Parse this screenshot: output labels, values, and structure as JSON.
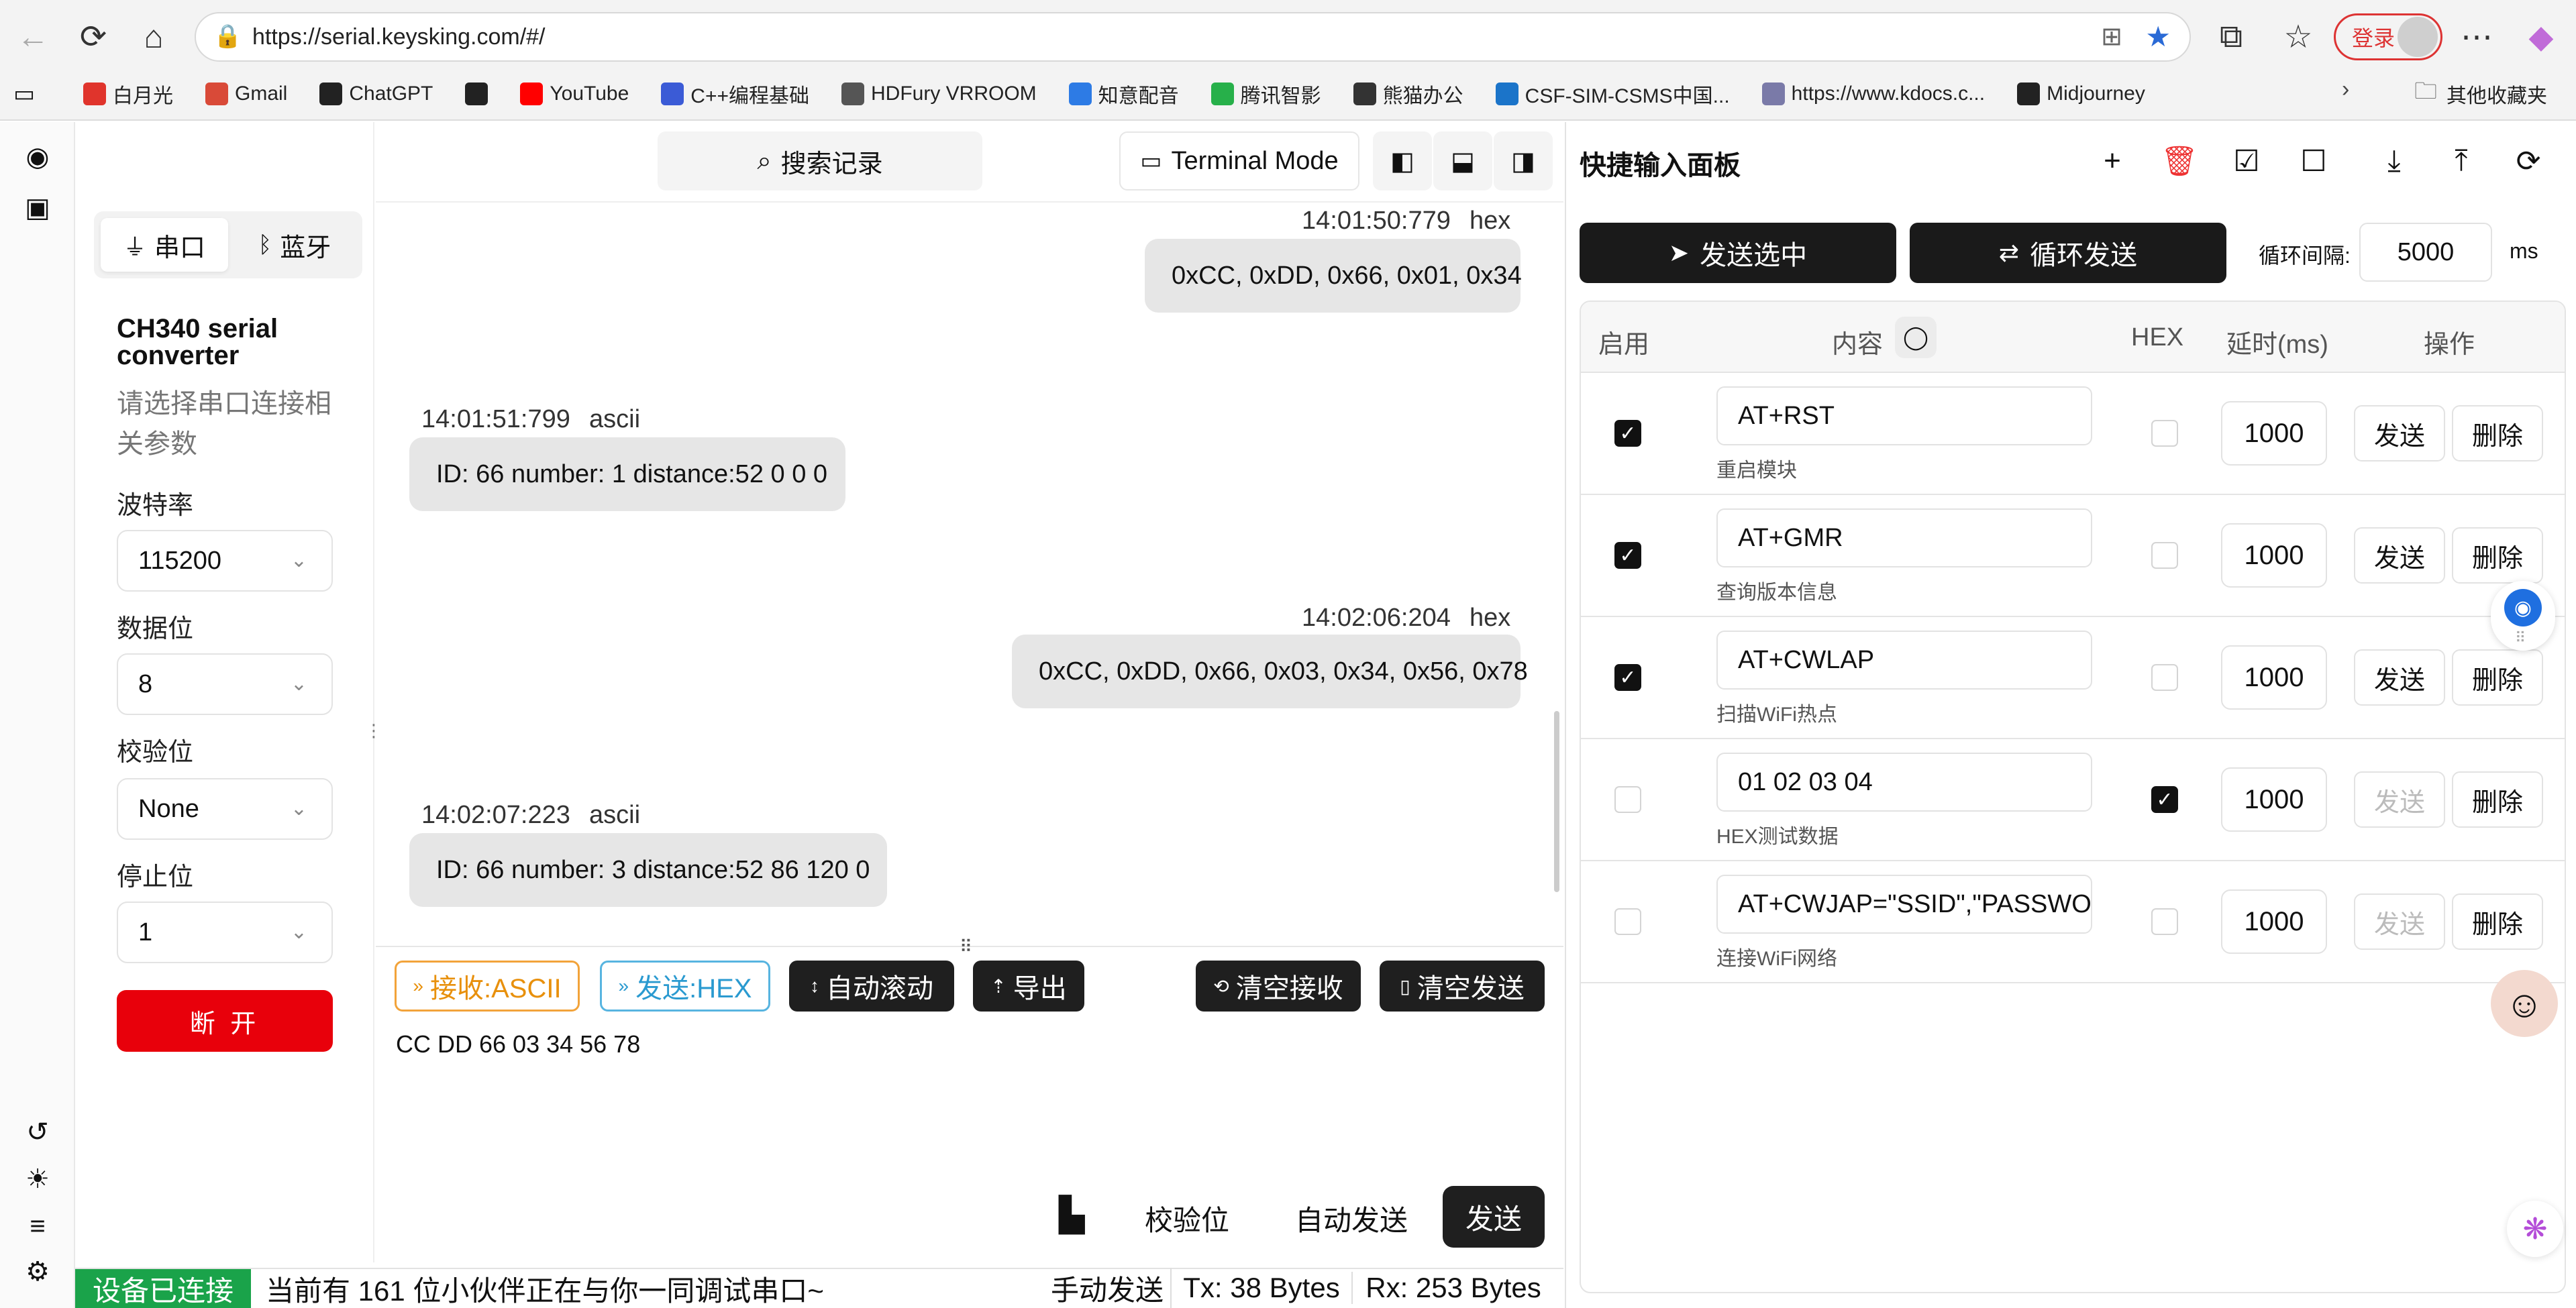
{
  "browser": {
    "url": "https://serial.keysking.com/#/",
    "login_label": "登录",
    "bookmarks": [
      {
        "label": "白月光",
        "color": "#e0342c"
      },
      {
        "label": "Gmail",
        "color": "#d94a38"
      },
      {
        "label": "ChatGPT",
        "color": "#222222"
      },
      {
        "label": "",
        "color": "#222222"
      },
      {
        "label": "YouTube",
        "color": "#ff0000"
      },
      {
        "label": "C++编程基础",
        "color": "#3b5bd6"
      },
      {
        "label": "HDFury VRROOM",
        "color": "#555555"
      },
      {
        "label": "知意配音",
        "color": "#2d7be5"
      },
      {
        "label": "腾讯智影",
        "color": "#27b04a"
      },
      {
        "label": "熊猫办公",
        "color": "#333333"
      },
      {
        "label": "CSF-SIM-CSMS中国...",
        "color": "#1b74c9"
      },
      {
        "label": "https://www.kdocs.c...",
        "color": "#7a7aa8"
      },
      {
        "label": "Midjourney",
        "color": "#222222"
      }
    ],
    "other_bookmarks": "其他收藏夹"
  },
  "left": {
    "tab_serial": "串口",
    "tab_bluetooth": "蓝牙",
    "device_name": "CH340 serial converter",
    "hint": "请选择串口连接相关参数",
    "baud_label": "波特率",
    "baud_value": "115200",
    "databits_label": "数据位",
    "databits_value": "8",
    "parity_label": "校验位",
    "parity_value": "None",
    "stopbits_label": "停止位",
    "stopbits_value": "1",
    "disconnect_label": "断 开"
  },
  "top": {
    "search_label": "搜索记录",
    "terminal_label": "Terminal Mode"
  },
  "messages": [
    {
      "time": "14:01:50:779",
      "fmt": "hex",
      "text": "0xCC, 0xDD, 0x66, 0x01, 0x34",
      "dir": "out"
    },
    {
      "time": "14:01:51:799",
      "fmt": "ascii",
      "text": "ID: 66 number: 1 distance:52 0 0 0",
      "dir": "in"
    },
    {
      "time": "14:02:06:204",
      "fmt": "hex",
      "text": "0xCC, 0xDD, 0x66, 0x03, 0x34, 0x56, 0x78",
      "dir": "out"
    },
    {
      "time": "14:02:07:223",
      "fmt": "ascii",
      "text": "ID: 66 number: 3 distance:52 86 120 0",
      "dir": "in"
    }
  ],
  "toolbar": {
    "recv_ascii": "接收:ASCII",
    "send_hex": "发送:HEX",
    "auto_scroll": "自动滚动",
    "export": "导出",
    "clear_recv": "清空接收",
    "clear_send": "清空发送"
  },
  "input_text": "CC DD 66 03 34 56 78",
  "bottom": {
    "checksum": "校验位",
    "auto_send": "自动发送",
    "send": "发送"
  },
  "status": {
    "connected": "设备已连接",
    "message": "当前有 161 位小伙伴正在与你一同调试串口~",
    "manual_send": "手动发送",
    "tx": "Tx: 38 Bytes",
    "rx": "Rx: 253 Bytes"
  },
  "quick": {
    "title": "快捷输入面板",
    "send_selected": "发送选中",
    "loop_send": "循环发送",
    "interval_label": "循环间隔:",
    "interval_value": "5000",
    "interval_unit": "ms",
    "headers": {
      "enable": "启用",
      "content": "内容",
      "hex": "HEX",
      "delay": "延时(ms)",
      "action": "操作"
    },
    "send_btn": "发送",
    "delete_btn": "删除",
    "rows": [
      {
        "enabled": true,
        "content": "AT+RST",
        "desc": "重启模块",
        "hex": false,
        "delay": "1000"
      },
      {
        "enabled": true,
        "content": "AT+GMR",
        "desc": "查询版本信息",
        "hex": false,
        "delay": "1000"
      },
      {
        "enabled": true,
        "content": "AT+CWLAP",
        "desc": "扫描WiFi热点",
        "hex": false,
        "delay": "1000"
      },
      {
        "enabled": false,
        "content": "01 02 03 04",
        "desc": "HEX测试数据",
        "hex": true,
        "delay": "1000"
      },
      {
        "enabled": false,
        "content": "AT+CWJAP=\"SSID\",\"PASSWORD\"",
        "desc": "连接WiFi网络",
        "hex": false,
        "delay": "1000"
      }
    ]
  }
}
